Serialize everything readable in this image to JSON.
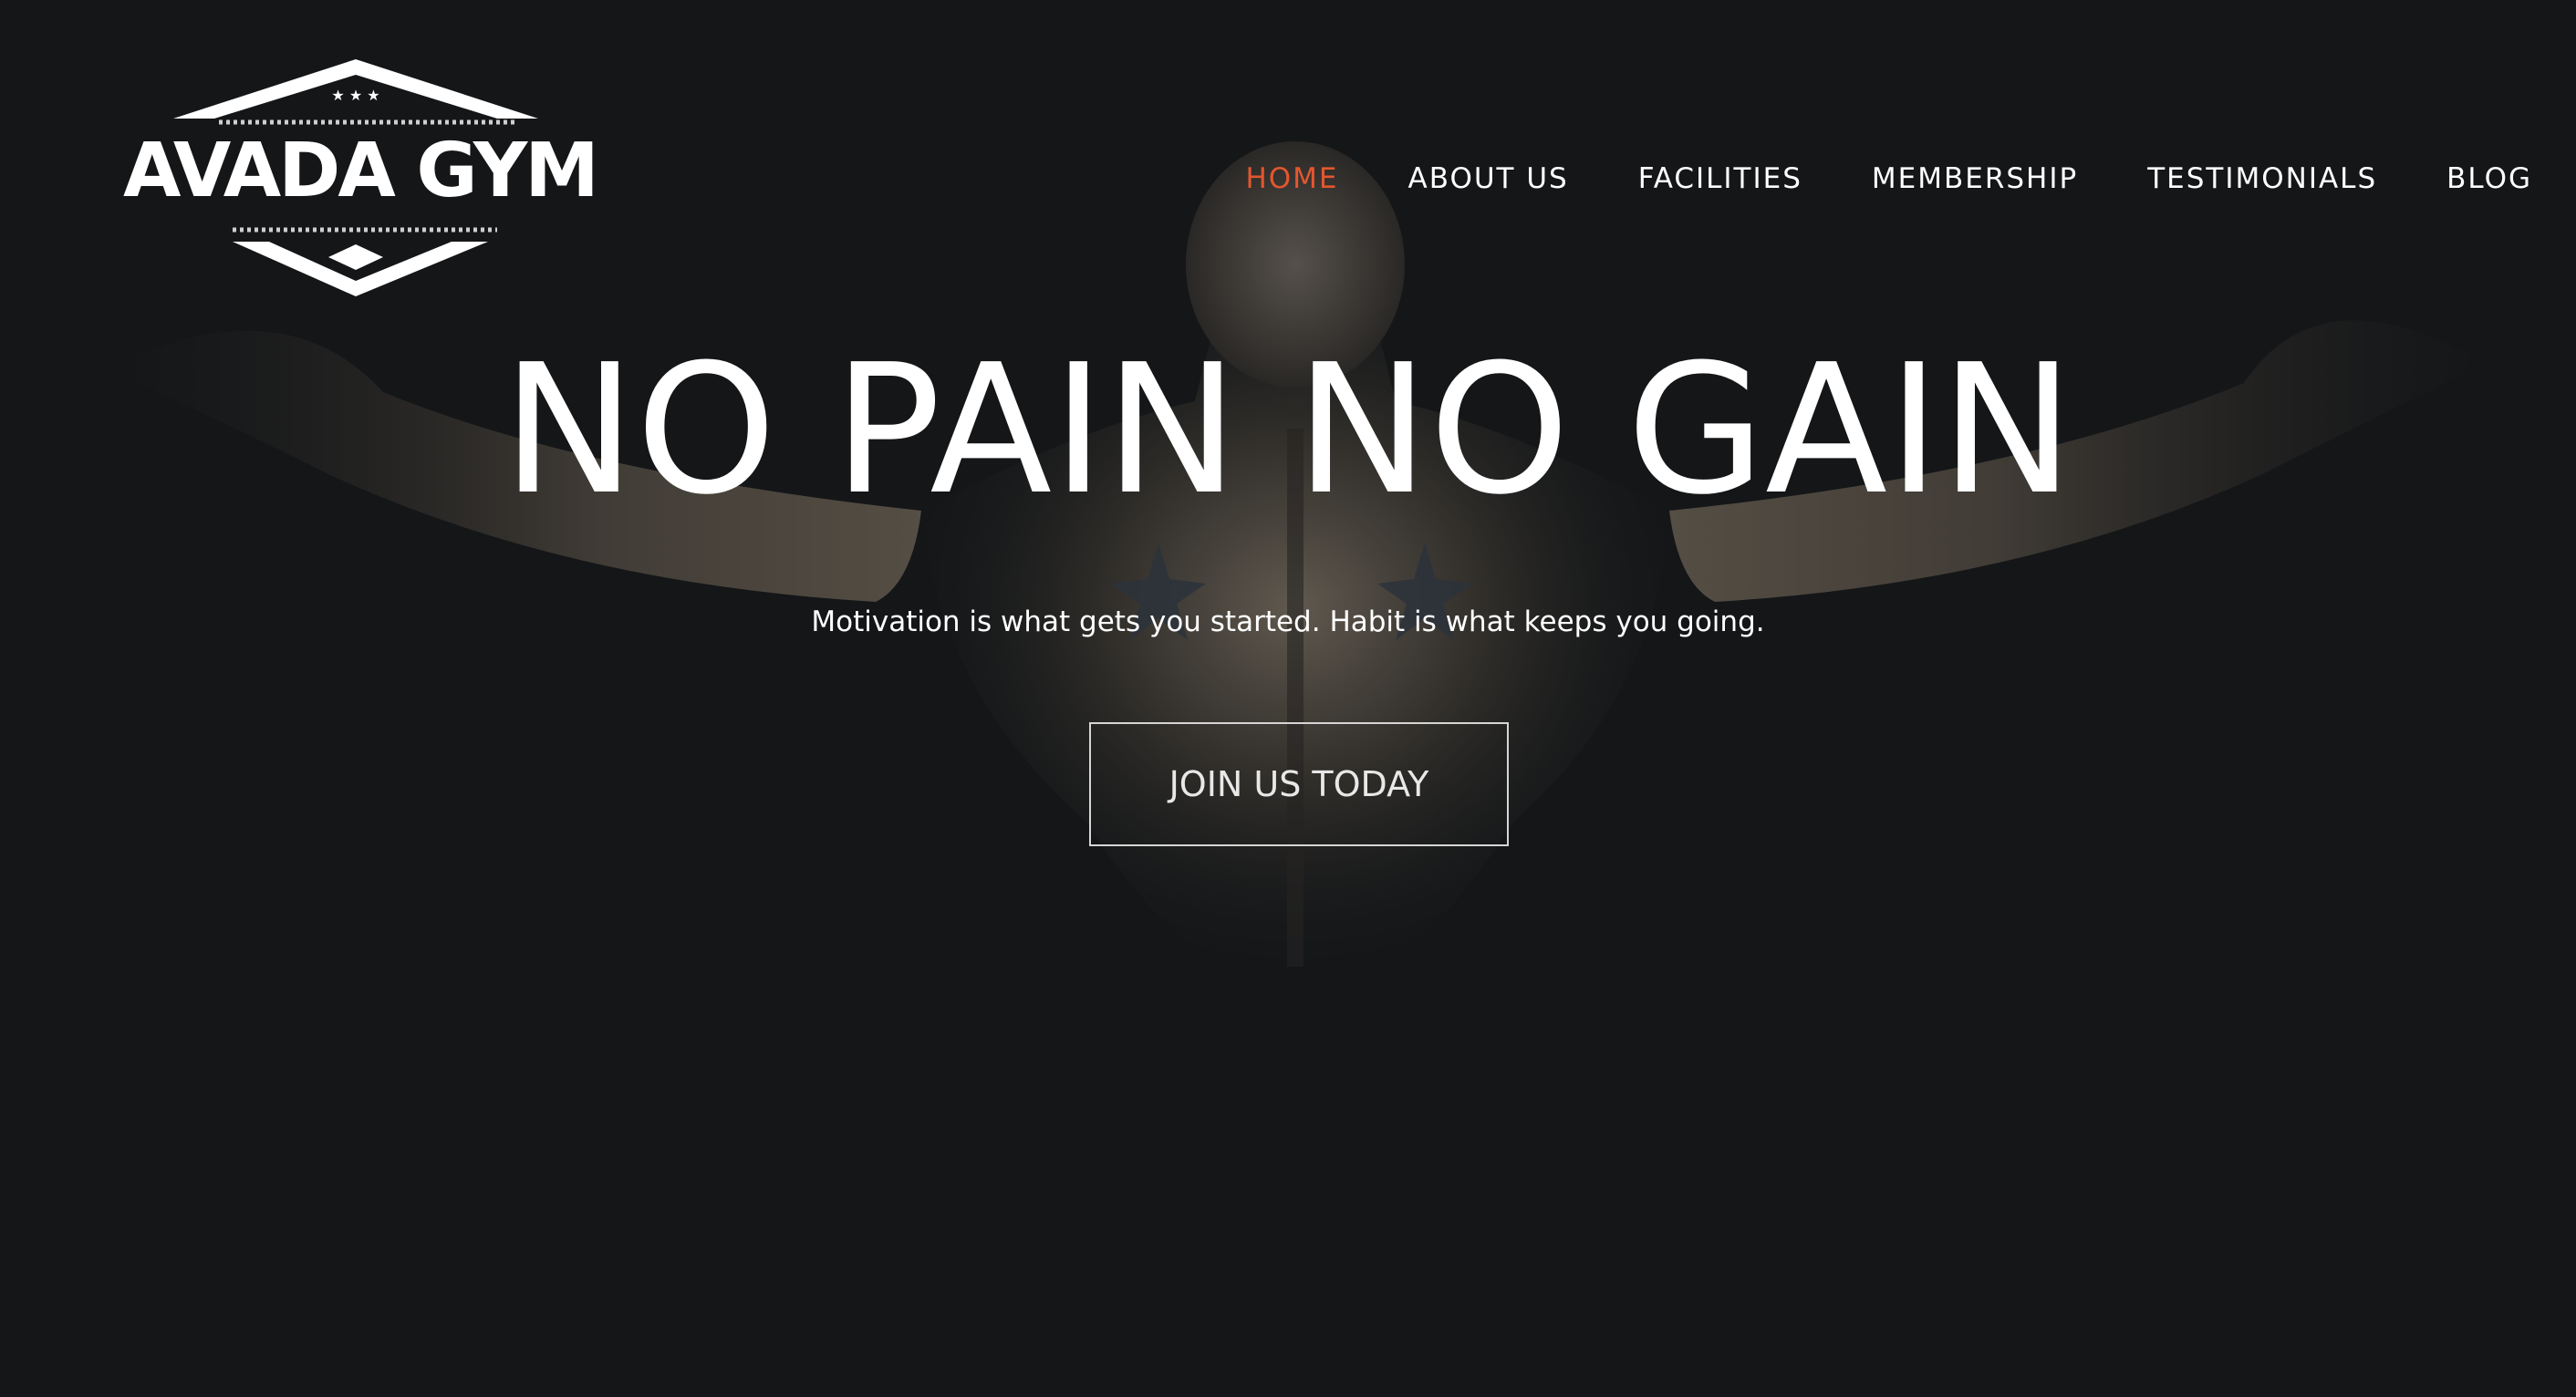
{
  "brand": {
    "logo_text": "AVADA GYM"
  },
  "nav": {
    "items": [
      {
        "label": "HOME",
        "active": true
      },
      {
        "label": "ABOUT US",
        "active": false
      },
      {
        "label": "FACILITIES",
        "active": false
      },
      {
        "label": "MEMBERSHIP",
        "active": false
      },
      {
        "label": "TESTIMONIALS",
        "active": false
      },
      {
        "label": "BLOG",
        "active": false
      }
    ]
  },
  "hero": {
    "headline": "NO PAIN NO GAIN",
    "tagline": "Motivation is what gets you started. Habit is what keeps you going.",
    "cta_label": "JOIN US TODAY"
  },
  "colors": {
    "background": "#141618",
    "accent": "#e2572e",
    "text": "#ffffff",
    "button_border": "#d6d6d6"
  }
}
